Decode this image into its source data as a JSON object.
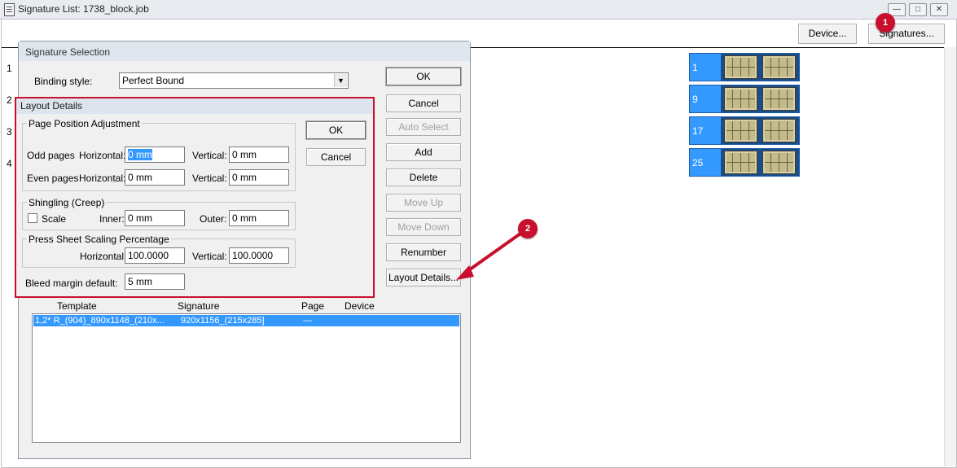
{
  "window": {
    "title": "Signature List:  1738_block.job",
    "minimize_icon": "minimize-icon",
    "restore_icon": "restore-icon",
    "close_icon": "close-icon"
  },
  "toolbar": {
    "device_label": "Device...",
    "signatures_label": "Signatures..."
  },
  "signature_blocks": [
    {
      "number": "1",
      "sheets": 2
    },
    {
      "number": "9",
      "sheets": 2
    },
    {
      "number": "17",
      "sheets": 2
    },
    {
      "number": "25",
      "sheets": 2
    }
  ],
  "left_numbers": [
    "1",
    "2",
    "3",
    "4"
  ],
  "signature_selection": {
    "title": "Signature Selection",
    "binding_style_label": "Binding style:",
    "binding_style_value": "Perfect Bound",
    "buttons": {
      "ok": "OK",
      "cancel": "Cancel",
      "auto_select": "Auto Select",
      "add": "Add",
      "delete": "Delete",
      "move_up": "Move Up",
      "move_down": "Move Down",
      "renumber": "Renumber",
      "layout_details": "Layout Details..."
    },
    "list_headers": [
      "Template",
      "Signature",
      "Page",
      "Device"
    ],
    "list_rows": [
      {
        "template": "1,2*   R_(904)_890x1148_(210x...",
        "signature": "920x1156_(215x285]",
        "page": "---",
        "device": ""
      }
    ]
  },
  "layout_details": {
    "title": "Layout Details",
    "page_position_group": "Page Position Adjustment",
    "odd_pages_label": "Odd pages",
    "even_pages_label": "Even pages",
    "horizontal_label": "Horizontal:",
    "vertical_label": "Vertical:",
    "odd_horizontal": "0 mm",
    "odd_vertical": "0 mm",
    "even_horizontal": "0 mm",
    "even_vertical": "0 mm",
    "ok": "OK",
    "cancel": "Cancel",
    "shingling_group": "Shingling (Creep)",
    "scale_label": "Scale",
    "scale_checked": false,
    "inner_label": "Inner:",
    "inner_value": "0 mm",
    "outer_label": "Outer:",
    "outer_value": "0 mm",
    "scaling_group": "Press Sheet Scaling Percentage",
    "scaling_horizontal": "100.0000",
    "scaling_vertical": "100.0000",
    "bleed_label": "Bleed margin default:",
    "bleed_value": "5 mm"
  },
  "annotations": {
    "marker_1": "1",
    "marker_2": "2",
    "marker_color": "#c8102e"
  },
  "colors": {
    "selection": "#3399ff",
    "block_fill": "#3399ff",
    "sheet_fill": "#c4ba8a"
  }
}
